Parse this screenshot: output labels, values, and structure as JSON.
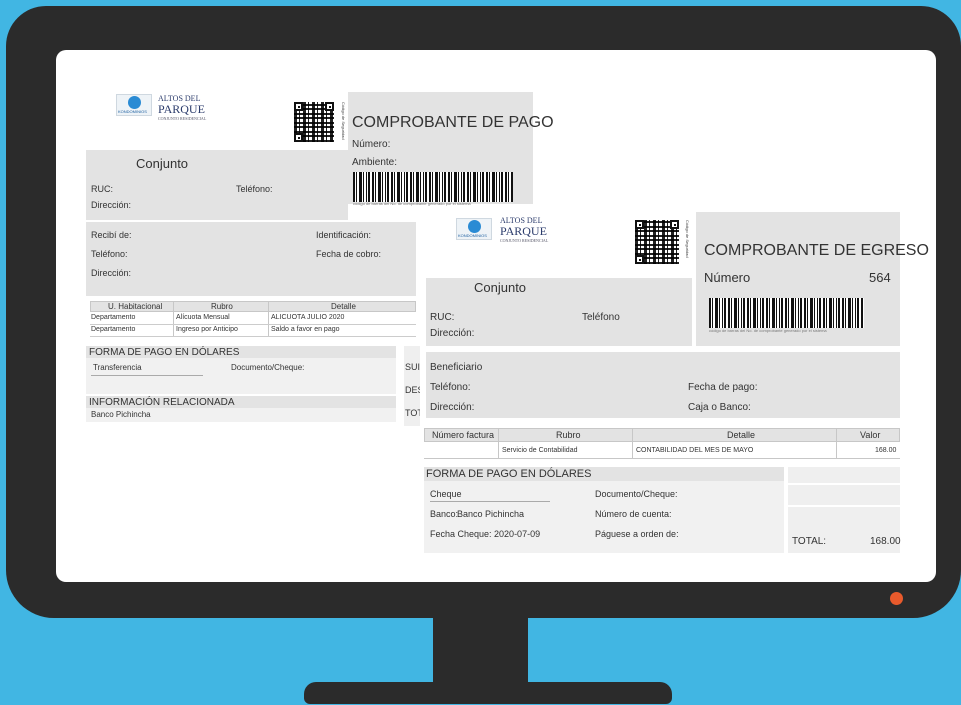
{
  "logo": {
    "line1": "ALTOS DEL",
    "line2": "PARQUE",
    "line3": "CONJUNTO RESIDENCIAL",
    "badge": "KONDOMINIOS"
  },
  "qr_side_text": "Código de Seguridad",
  "doc1": {
    "title": "COMPROBANTE DE PAGO",
    "numero_label": "Número:",
    "ambiente_label": "Ambiente:",
    "barcode_caption": "código de barras del No. de comprobante generado por el sistema",
    "conjunto": "Conjunto",
    "ruc_label": "RUC:",
    "telefono_label": "Teléfono:",
    "direccion_label": "Dirección:",
    "recibi_label": "Recibí de:",
    "identificacion_label": "Identificación:",
    "telefono2_label": "Teléfono:",
    "fecha_cobro_label": "Fecha de cobro:",
    "direccion2_label": "Dirección:",
    "table": {
      "headers": [
        "U. Habitacional",
        "Rubro",
        "Detalle"
      ],
      "rows": [
        [
          "Departamento",
          "Alícuota Mensual",
          "ALICUOTA JULIO 2020"
        ],
        [
          "Departamento",
          "Ingreso por Anticipo",
          "Saldo a favor en pago"
        ]
      ]
    },
    "forma_pago_label": "FORMA DE PAGO EN DÓLARES",
    "forma_pago_value": "Transferencia",
    "documento_label": "Documento/Cheque:",
    "sub_label": "SUI",
    "des_label": "DES",
    "tot_label": "TOT",
    "info_label": "INFORMACIÓN RELACIONADA",
    "banco": "Banco Pichincha"
  },
  "doc2": {
    "title": "COMPROBANTE DE EGRESO",
    "numero_label": "Número",
    "numero_value": "564",
    "barcode_caption": "código de barras del No. de comprobante generado por el sistema",
    "conjunto": "Conjunto",
    "ruc_label": "RUC:",
    "telefono_label": "Teléfono",
    "direccion_label": "Dirección:",
    "beneficiario_label": "Beneficiario",
    "telefono2_label": "Teléfono:",
    "fecha_pago_label": "Fecha de pago:",
    "direccion2_label": "Dirección:",
    "caja_label": "Caja o Banco:",
    "table": {
      "headers": [
        "Número factura",
        "Rubro",
        "Detalle",
        "Valor"
      ],
      "rows": [
        [
          "",
          "Servicio de Contabilidad",
          "CONTABILIDAD DEL MES DE MAYO",
          "168.00"
        ]
      ]
    },
    "forma_pago_label": "FORMA DE PAGO EN  DÓLARES",
    "forma_pago_value": "Cheque",
    "documento_label": "Documento/Cheque:",
    "banco_label": "Banco:",
    "banco_value": "Banco Pichincha",
    "cuenta_label": "Número de cuenta:",
    "fecha_cheque": "Fecha Cheque: 2020-07-09",
    "paguese_label": "Páguese a orden de:",
    "total_label": "TOTAL:",
    "total_value": "168.00"
  },
  "colors": {
    "background": "#41b6e3",
    "monitor": "#2b2b2b",
    "power_led": "#e85a2c",
    "panel_gray": "#e3e3e3"
  }
}
